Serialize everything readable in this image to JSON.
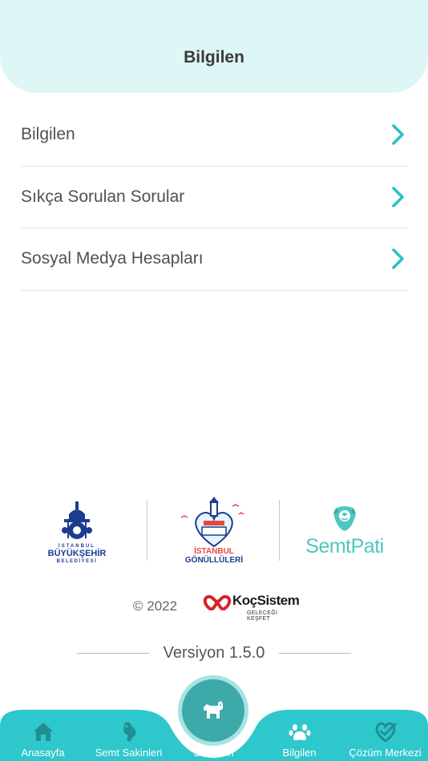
{
  "header": {
    "title": "Bilgilen"
  },
  "menu": {
    "items": [
      {
        "label": "Bilgilen",
        "icon": "chevron-right-icon"
      },
      {
        "label": "Sıkça Sorulan Sorular",
        "icon": "chevron-right-icon"
      },
      {
        "label": "Sosyal Medya Hesapları",
        "icon": "chevron-right-icon"
      }
    ]
  },
  "logos": {
    "ibb": {
      "line1": "İSTANBUL",
      "line2": "BÜYÜKŞEHİR",
      "line3": "BELEDİYESİ"
    },
    "gonulluleri": {
      "line1": "İSTANBUL",
      "line2": "GÖNÜLLÜLERİ"
    },
    "semtpati": {
      "name": "SemtPati"
    }
  },
  "footer": {
    "copyright": "© 2022",
    "partner_name": "KoçSistem",
    "partner_tagline": "GELECEĞİ KEŞFET",
    "version": "Versiyon 1.5.0"
  },
  "tabbar": {
    "tabs": [
      {
        "label": "Anasayfa",
        "icon": "home-icon"
      },
      {
        "label": "Semt Sakinleri",
        "icon": "pets-group-icon"
      },
      {
        "label": "Sahiplen",
        "icon": "dog-icon"
      },
      {
        "label": "Bilgilen",
        "icon": "paw-icon"
      },
      {
        "label": "Çözüm Merkezi",
        "icon": "heart-check-icon"
      }
    ],
    "active_index": 3
  },
  "colors": {
    "header_bg": "#dff6f6",
    "accent": "#2fbfc4",
    "tabbar_bg": "#2ec7cc",
    "tab_inactive": "#1f8f93",
    "center_button": "#3ea9a9",
    "ibb_blue": "#1b3d8f",
    "semtpati_green": "#4fc7bf"
  }
}
